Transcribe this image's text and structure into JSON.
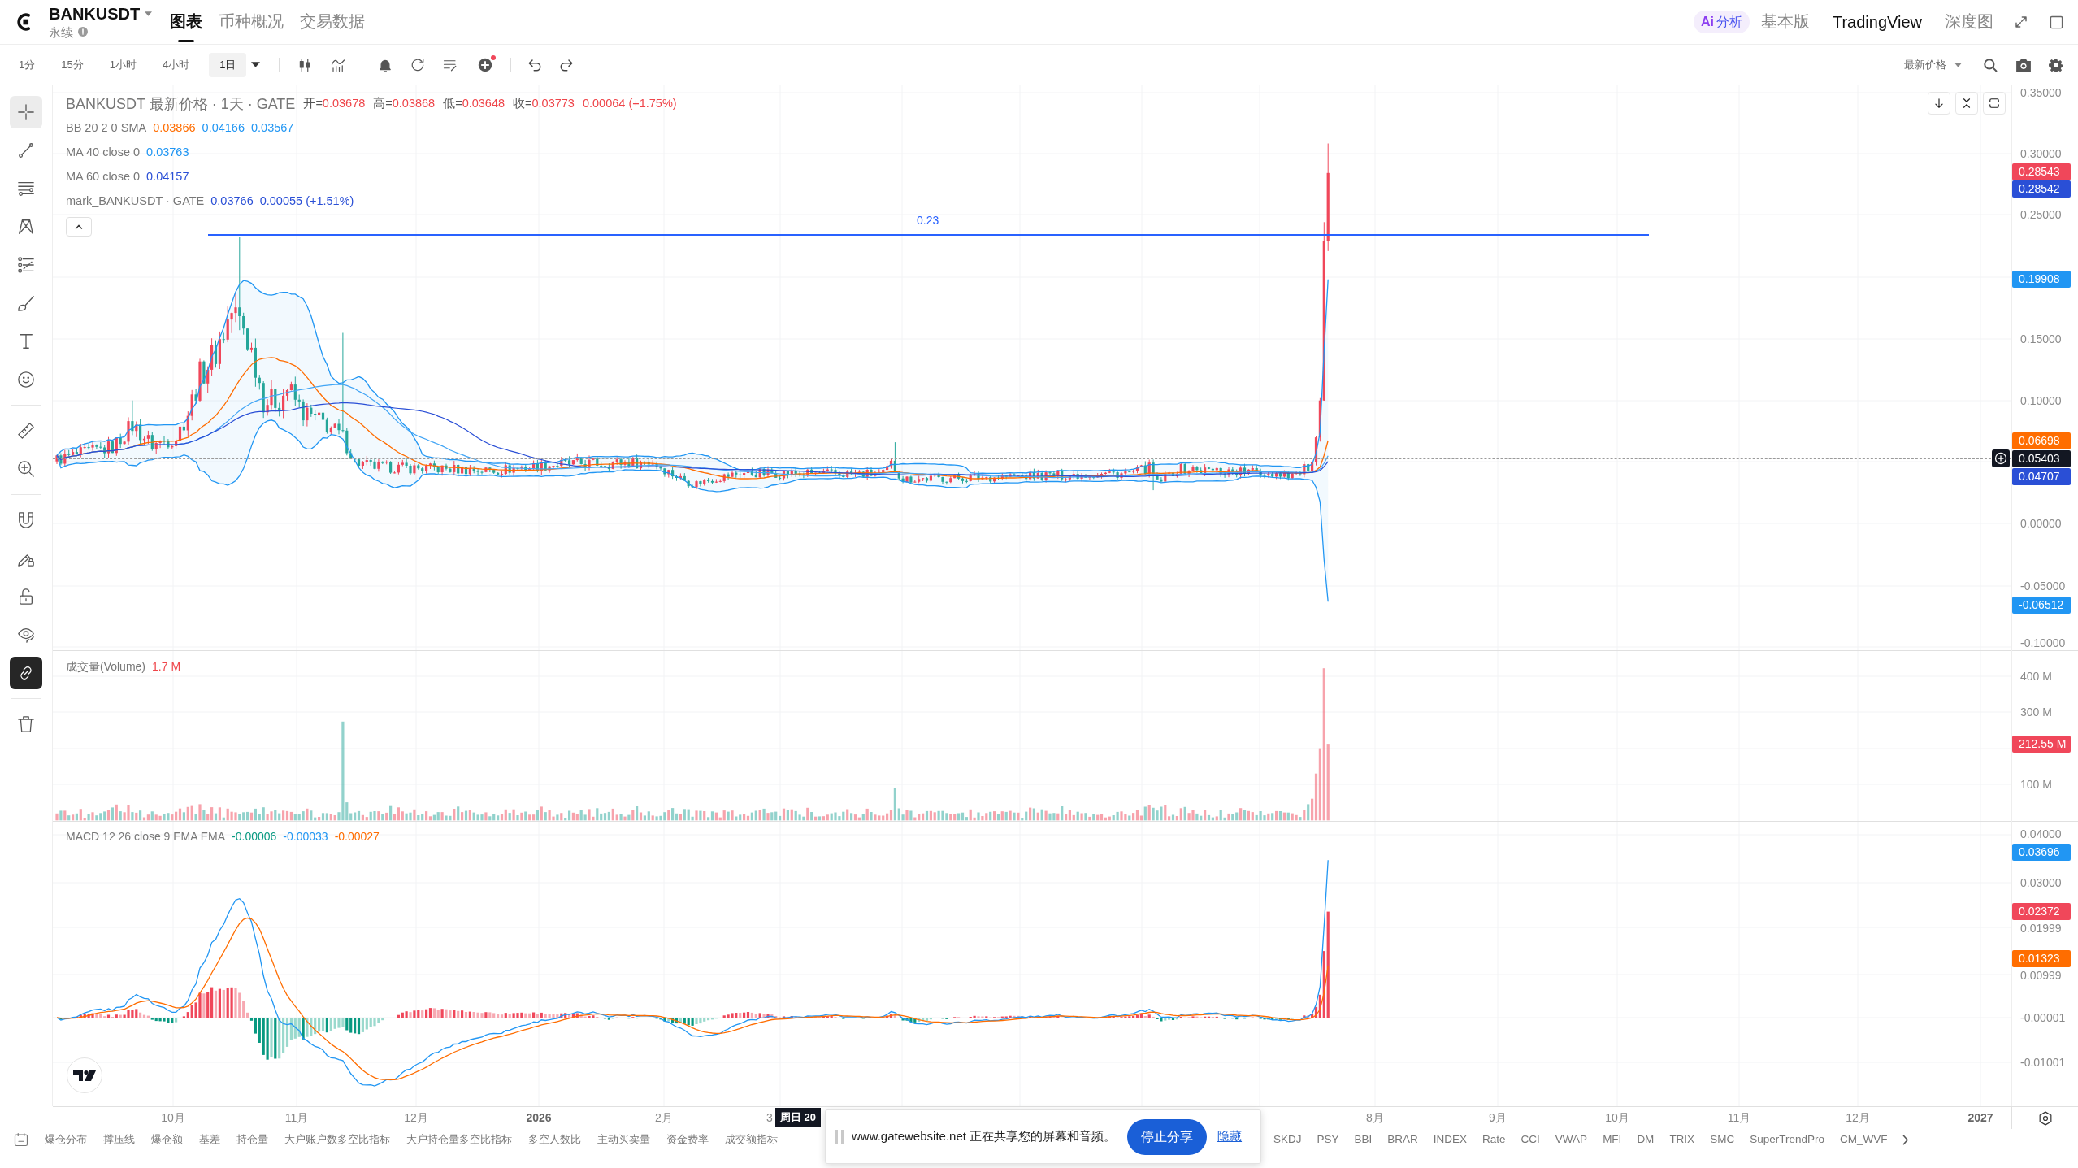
{
  "header": {
    "symbol": "BANKUSDT",
    "contract": "永续",
    "tabs": [
      {
        "label": "图表",
        "selected": true
      },
      {
        "label": "币种概况",
        "selected": false
      },
      {
        "label": "交易数据",
        "selected": false
      }
    ],
    "ai_button": {
      "badge": "Ai",
      "label": "分析"
    },
    "views": [
      {
        "label": "基本版",
        "selected": false
      },
      {
        "label": "TradingView",
        "selected": true
      },
      {
        "label": "深度图",
        "selected": false
      }
    ]
  },
  "toolbar": {
    "intervals": [
      {
        "label": "1分",
        "selected": false
      },
      {
        "label": "15分",
        "selected": false
      },
      {
        "label": "1小时",
        "selected": false
      },
      {
        "label": "4小时",
        "selected": false
      },
      {
        "label": "1日",
        "selected": true
      }
    ],
    "price_source": "最新价格"
  },
  "tool_groups": [
    {
      "tools": [
        {
          "kind": "crosshair",
          "selected": true
        },
        {
          "kind": "trend_line",
          "selected": false
        },
        {
          "kind": "parallel_lines",
          "selected": false
        },
        {
          "kind": "pattern",
          "selected": false
        },
        {
          "kind": "fib",
          "selected": false
        },
        {
          "kind": "brush",
          "selected": false
        },
        {
          "kind": "text",
          "selected": false
        },
        {
          "kind": "emoji",
          "selected": false
        }
      ]
    },
    {
      "tools": [
        {
          "kind": "ruler",
          "selected": false
        },
        {
          "kind": "zoom",
          "selected": false
        }
      ]
    },
    {
      "tools": [
        {
          "kind": "magnet",
          "selected": false
        },
        {
          "kind": "draw_lock",
          "selected": false
        },
        {
          "kind": "lock",
          "selected": false
        },
        {
          "kind": "visibility",
          "selected": false
        },
        {
          "kind": "sync",
          "selected": true
        }
      ]
    },
    {
      "tools": [
        {
          "kind": "trash",
          "selected": false
        }
      ]
    }
  ],
  "price_pane": {
    "legend": {
      "title": "BANKUSDT 最新价格 · 1天 · GATE",
      "ohlc": [
        {
          "label": "开=",
          "value": "0.03678"
        },
        {
          "label": "高=",
          "value": "0.03868"
        },
        {
          "label": "低=",
          "value": "0.03648"
        },
        {
          "label": "收=",
          "value": "0.03773"
        }
      ],
      "change": "0.00064 (+1.75%)",
      "indicators": [
        {
          "name": "BB 20 2 0 SMA",
          "values": [
            {
              "text": "0.03866",
              "color": "#ff6d00"
            },
            {
              "text": "0.04166",
              "color": "#2196f3"
            },
            {
              "text": "0.03567",
              "color": "#2196f3"
            }
          ]
        },
        {
          "name": "MA 40 close 0",
          "values": [
            {
              "text": "0.03763",
              "color": "#2196f3"
            }
          ]
        },
        {
          "name": "MA 60 close 0",
          "values": [
            {
              "text": "0.04157",
              "color": "#2a4fd6"
            }
          ]
        },
        {
          "name": "mark_BANKUSDT · GATE",
          "values": [
            {
              "text": "0.03766",
              "color": "#2a4fd6"
            },
            {
              "text": "0.00055 (+1.51%)",
              "color": "#2a4fd6"
            }
          ]
        }
      ]
    },
    "drawing_label": "0.23",
    "axis_ticks": [
      "0.35000",
      "0.30000",
      "0.25000",
      "0.15000",
      "0.10000",
      "0.00000",
      "-0.05000",
      "-0.10000"
    ],
    "tags": [
      {
        "text": "0.28543",
        "color": "#f0475a"
      },
      {
        "text": "0.28542",
        "color": "#2a4fd6"
      },
      {
        "text": "0.19908",
        "color": "#2196f3"
      },
      {
        "text": "0.06698",
        "color": "#ff6d00"
      },
      {
        "text": "0.04707",
        "color": "#2a4fd6"
      },
      {
        "text": "-0.06512",
        "color": "#2196f3"
      }
    ],
    "crosshair_tag": "0.05403"
  },
  "volume_pane": {
    "title": "成交量(Volume)",
    "value": "1.7 M",
    "axis_ticks": [
      "400 M",
      "300 M",
      "100 M"
    ],
    "tags": [
      {
        "text": "212.55 M",
        "color": "#f0475a"
      }
    ]
  },
  "macd_pane": {
    "title": "MACD 12 26 close 9 EMA EMA",
    "values": [
      {
        "text": "-0.00006",
        "color": "#089981"
      },
      {
        "text": "-0.00033",
        "color": "#2196f3"
      },
      {
        "text": "-0.00027",
        "color": "#ff6d00"
      }
    ],
    "axis_ticks": [
      "0.04000",
      "0.03000",
      "0.01999",
      "0.00999",
      "-0.00001",
      "-0.01001"
    ],
    "tags": [
      {
        "text": "0.03696",
        "color": "#2196f3"
      },
      {
        "text": "0.02372",
        "color": "#f0475a"
      },
      {
        "text": "0.01323",
        "color": "#ff6d00"
      }
    ]
  },
  "time_axis": {
    "labels": [
      {
        "text": "10月",
        "kind": "month"
      },
      {
        "text": "11月",
        "kind": "month"
      },
      {
        "text": "12月",
        "kind": "month"
      },
      {
        "text": "2026",
        "kind": "year"
      },
      {
        "text": "2月",
        "kind": "month"
      },
      {
        "text": "3",
        "kind": "month"
      },
      {
        "text": "8月",
        "kind": "month"
      },
      {
        "text": "9月",
        "kind": "month"
      },
      {
        "text": "10月",
        "kind": "month"
      },
      {
        "text": "11月",
        "kind": "month"
      },
      {
        "text": "12月",
        "kind": "month"
      },
      {
        "text": "2027",
        "kind": "year"
      }
    ],
    "crosshair_label": "周日 20"
  },
  "bottom_bar": {
    "indicators_left": [
      "爆仓分布",
      "撑压线",
      "爆仓额",
      "基差",
      "持仓量",
      "大户账户数多空比指标",
      "大户持仓量多空比指标",
      "多空人数比",
      "主动买卖量",
      "资金费率",
      "成交额指标"
    ],
    "indicators_right": [
      "SKDJ",
      "PSY",
      "BBI",
      "BRAR",
      "INDEX",
      "Rate",
      "CCI",
      "VWAP",
      "MFI",
      "DM",
      "TRIX",
      "SMC",
      "SuperTrendPro",
      "CM_WVF"
    ]
  },
  "share_notice": {
    "text": "www.gatewebsite.net 正在共享您的屏幕和音频。",
    "stop_button": "停止分享",
    "hide_link": "隐藏"
  }
}
